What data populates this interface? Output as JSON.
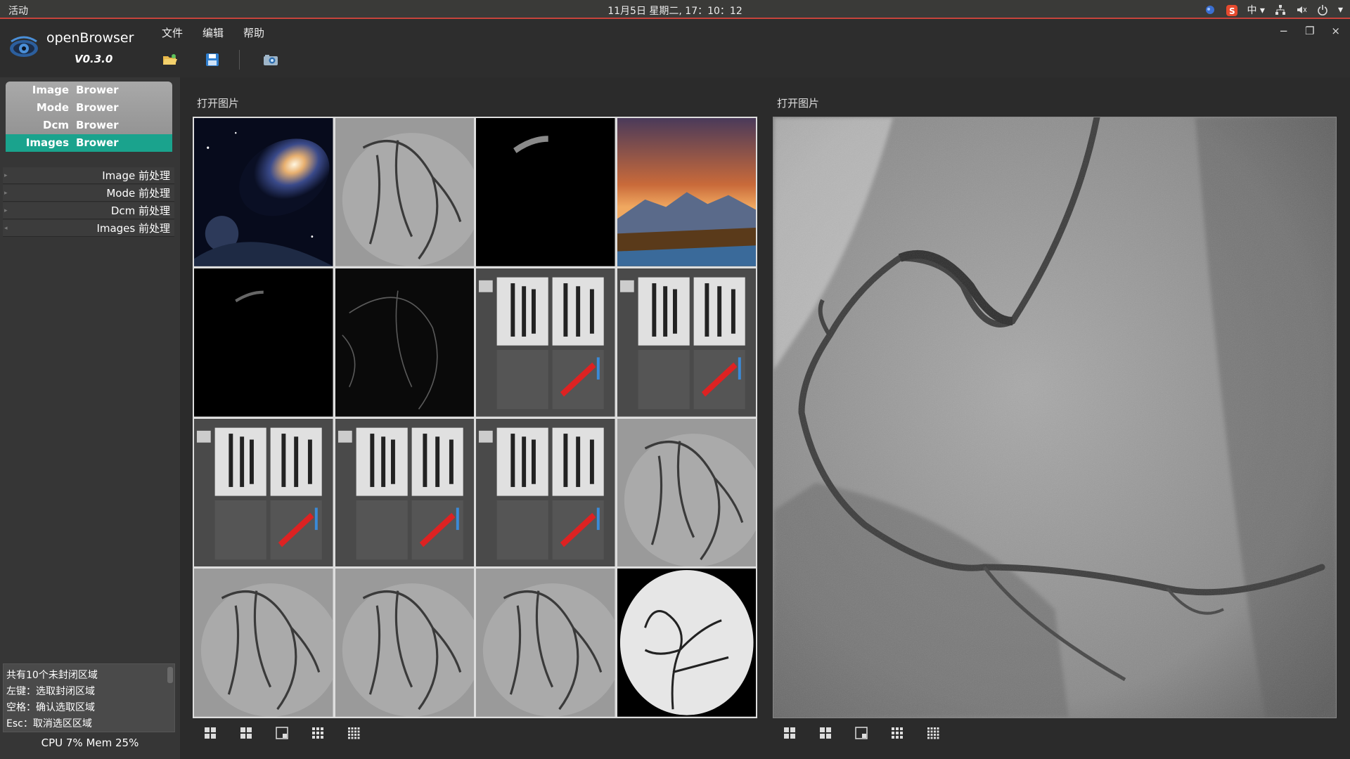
{
  "system_bar": {
    "activities": "活动",
    "clock": "11月5日 星期二, 17：10：12",
    "input_method": "中"
  },
  "app": {
    "name": "openBrowser",
    "version": "V0.3.0"
  },
  "menu": [
    "文件",
    "编辑",
    "帮助"
  ],
  "toolbar": [
    {
      "icon": "open-folder-icon"
    },
    {
      "icon": "save-icon"
    },
    {
      "icon": "camera-icon"
    }
  ],
  "nav": [
    {
      "a": "Image",
      "b": "Brower",
      "active": false
    },
    {
      "a": "Mode",
      "b": "Brower",
      "active": false
    },
    {
      "a": "Dcm",
      "b": "Brower",
      "active": false
    },
    {
      "a": "Images",
      "b": "Brower",
      "active": true
    }
  ],
  "tree": [
    {
      "label": "Image 前处理"
    },
    {
      "label": "Mode 前处理"
    },
    {
      "label": "Dcm 前处理"
    },
    {
      "label": "Images 前处理"
    }
  ],
  "status_lines": [
    "共有10个未封闭区域",
    "左键：选取封闭区域",
    "空格：确认选取区域",
    "Esc：取消选区区域"
  ],
  "cpu_mem": "CPU 7%  Mem 25%",
  "left_panel_title": "打开图片",
  "right_panel_title": "打开图片",
  "grid_images": [
    "galaxy",
    "angiogram",
    "black-vessel",
    "mountain-sunset",
    "black-vessel-small",
    "edge-map",
    "software-screenshot",
    "software-screenshot",
    "software-screenshot",
    "software-screenshot",
    "software-screenshot",
    "angiogram",
    "angiogram",
    "angiogram",
    "angiogram",
    "brain-angiogram"
  ],
  "layout_buttons": [
    "layout-1x1-icon",
    "layout-2x2-icon",
    "layout-split-icon",
    "layout-3x3-icon",
    "layout-4x4-icon"
  ],
  "colors": {
    "accent": "#1aa38d",
    "system_bar_underline": "#c8443c"
  }
}
